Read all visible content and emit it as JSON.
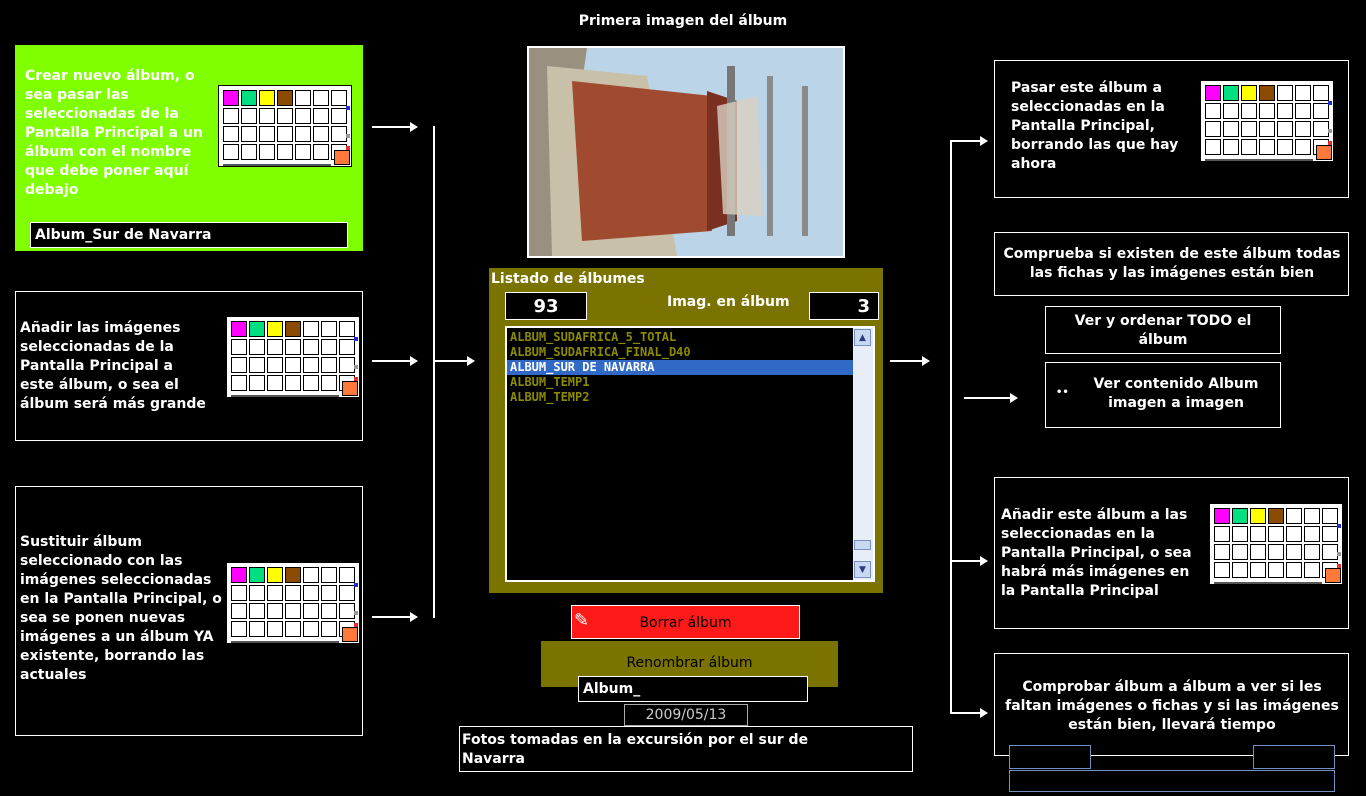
{
  "header_title": "Primera imagen del álbum",
  "left": {
    "create_text": "Crear nuevo álbum, o sea pasar las seleccionadas de la Pantalla Principal a un álbum con el nombre que debe poner aquí debajo",
    "new_album_name": "Album_Sur de Navarra",
    "add_text": "Añadir las imágenes seleccionadas de la Pantalla Principal a este álbum, o sea el álbum será más grande",
    "replace_text": "Sustituir álbum seleccionado con las imágenes seleccionadas en la Pantalla Principal, o sea se ponen nuevas imágenes a un álbum YA existente, borrando las actuales"
  },
  "center": {
    "list_title": "Listado de álbumes",
    "album_count": "93",
    "images_label": "Imag. en álbum",
    "images_count": "3",
    "albums": [
      "ALBUM_SUDAFRICA_5_TOTAL",
      "ALBUM_SUDAFRICA_FINAL_D40",
      "ALBUM_SUR DE NAVARRA",
      "ALBUM_TEMP1",
      "ALBUM_TEMP2"
    ],
    "selected_album": "ALBUM_SUR DE NAVARRA",
    "delete_label": "Borrar álbum",
    "rename_label": "Renombrar álbum",
    "rename_input": "Album_",
    "date": "2009/05/13",
    "description": "Fotos tomadas en la excursión por el sur de Navarra"
  },
  "right": {
    "pass_text": "Pasar este álbum a seleccionadas en la Pantalla Principal, borrando las que hay ahora",
    "check_text": "Comprueba si existen de este álbum todas las fichas y las imágenes están bien",
    "sort_label": "Ver y ordenar TODO el álbum",
    "view_label": "Ver contenido Album imagen a imagen",
    "add_to_text": "Añadir este álbum a las seleccionadas en la Pantalla Principal, o sea habrá más imágenes en la Pantalla Principal",
    "check_all_text": "Comprobar álbum a álbum a ver si les faltan imágenes o fichas y si las imágenes están bien, llevará tiempo"
  },
  "colors": {
    "create_panel": "#80ff00",
    "list_panel": "#7a7300",
    "delete_button": "#ff1a1a",
    "rename_button": "#7a7300",
    "selection": "#3169c6",
    "list_text": "#8c8a00"
  },
  "mini_grid_colors": [
    "#ff00ff",
    "#00e080",
    "#ffff00",
    "#8a4a00"
  ]
}
